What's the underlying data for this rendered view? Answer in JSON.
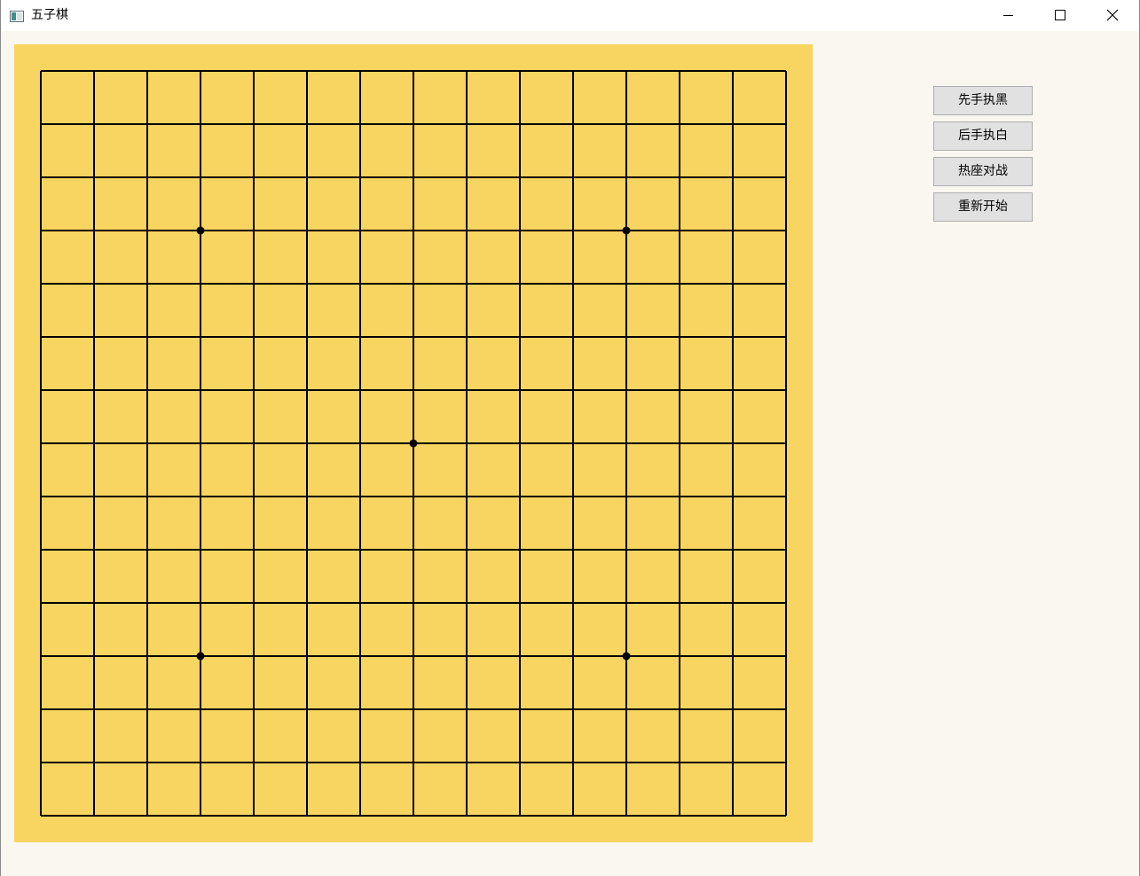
{
  "window": {
    "title": "五子棋",
    "app_icon": "app-window-icon",
    "controls": [
      "minimize-icon",
      "maximize-icon",
      "close-icon"
    ]
  },
  "board": {
    "grid_lines": 15,
    "star_points": [
      [
        3,
        3
      ],
      [
        3,
        11
      ],
      [
        7,
        7
      ],
      [
        11,
        3
      ],
      [
        11,
        11
      ]
    ],
    "stones": [],
    "colors": {
      "wood": "#f7d560",
      "line": "#000000",
      "background": "#f9f7f0"
    }
  },
  "buttons": {
    "first_black": "先手执黑",
    "second_white": "后手执白",
    "hotseat": "热座对战",
    "restart": "重新开始"
  }
}
